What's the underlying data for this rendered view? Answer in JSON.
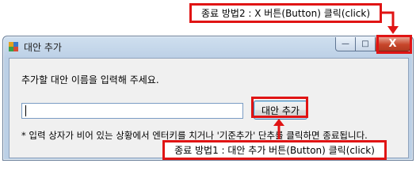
{
  "window": {
    "title": "대안 추가",
    "icons": {
      "app": "app-icon",
      "minimize": "minimize-icon",
      "maximize": "maximize-icon",
      "close": "close-icon"
    },
    "controls": {
      "minimize": "—",
      "maximize": "□",
      "close": "X"
    }
  },
  "form": {
    "prompt": "추가할 대안 이름을 입력해 주세요.",
    "input_value": "",
    "add_button_label": "대안 추가",
    "hint": "* 입력 상자가 비어 있는 상황에서 엔터키를 치거나 '기준추가' 단추를 클릭하면 종료됩니다."
  },
  "annotations": {
    "top": "종료 방법2 : X 버튼(Button) 클릭(click)",
    "bottom": "종료 방법1 : 대안 추가 버튼(Button) 클릭(click)",
    "color": "#e01414"
  }
}
